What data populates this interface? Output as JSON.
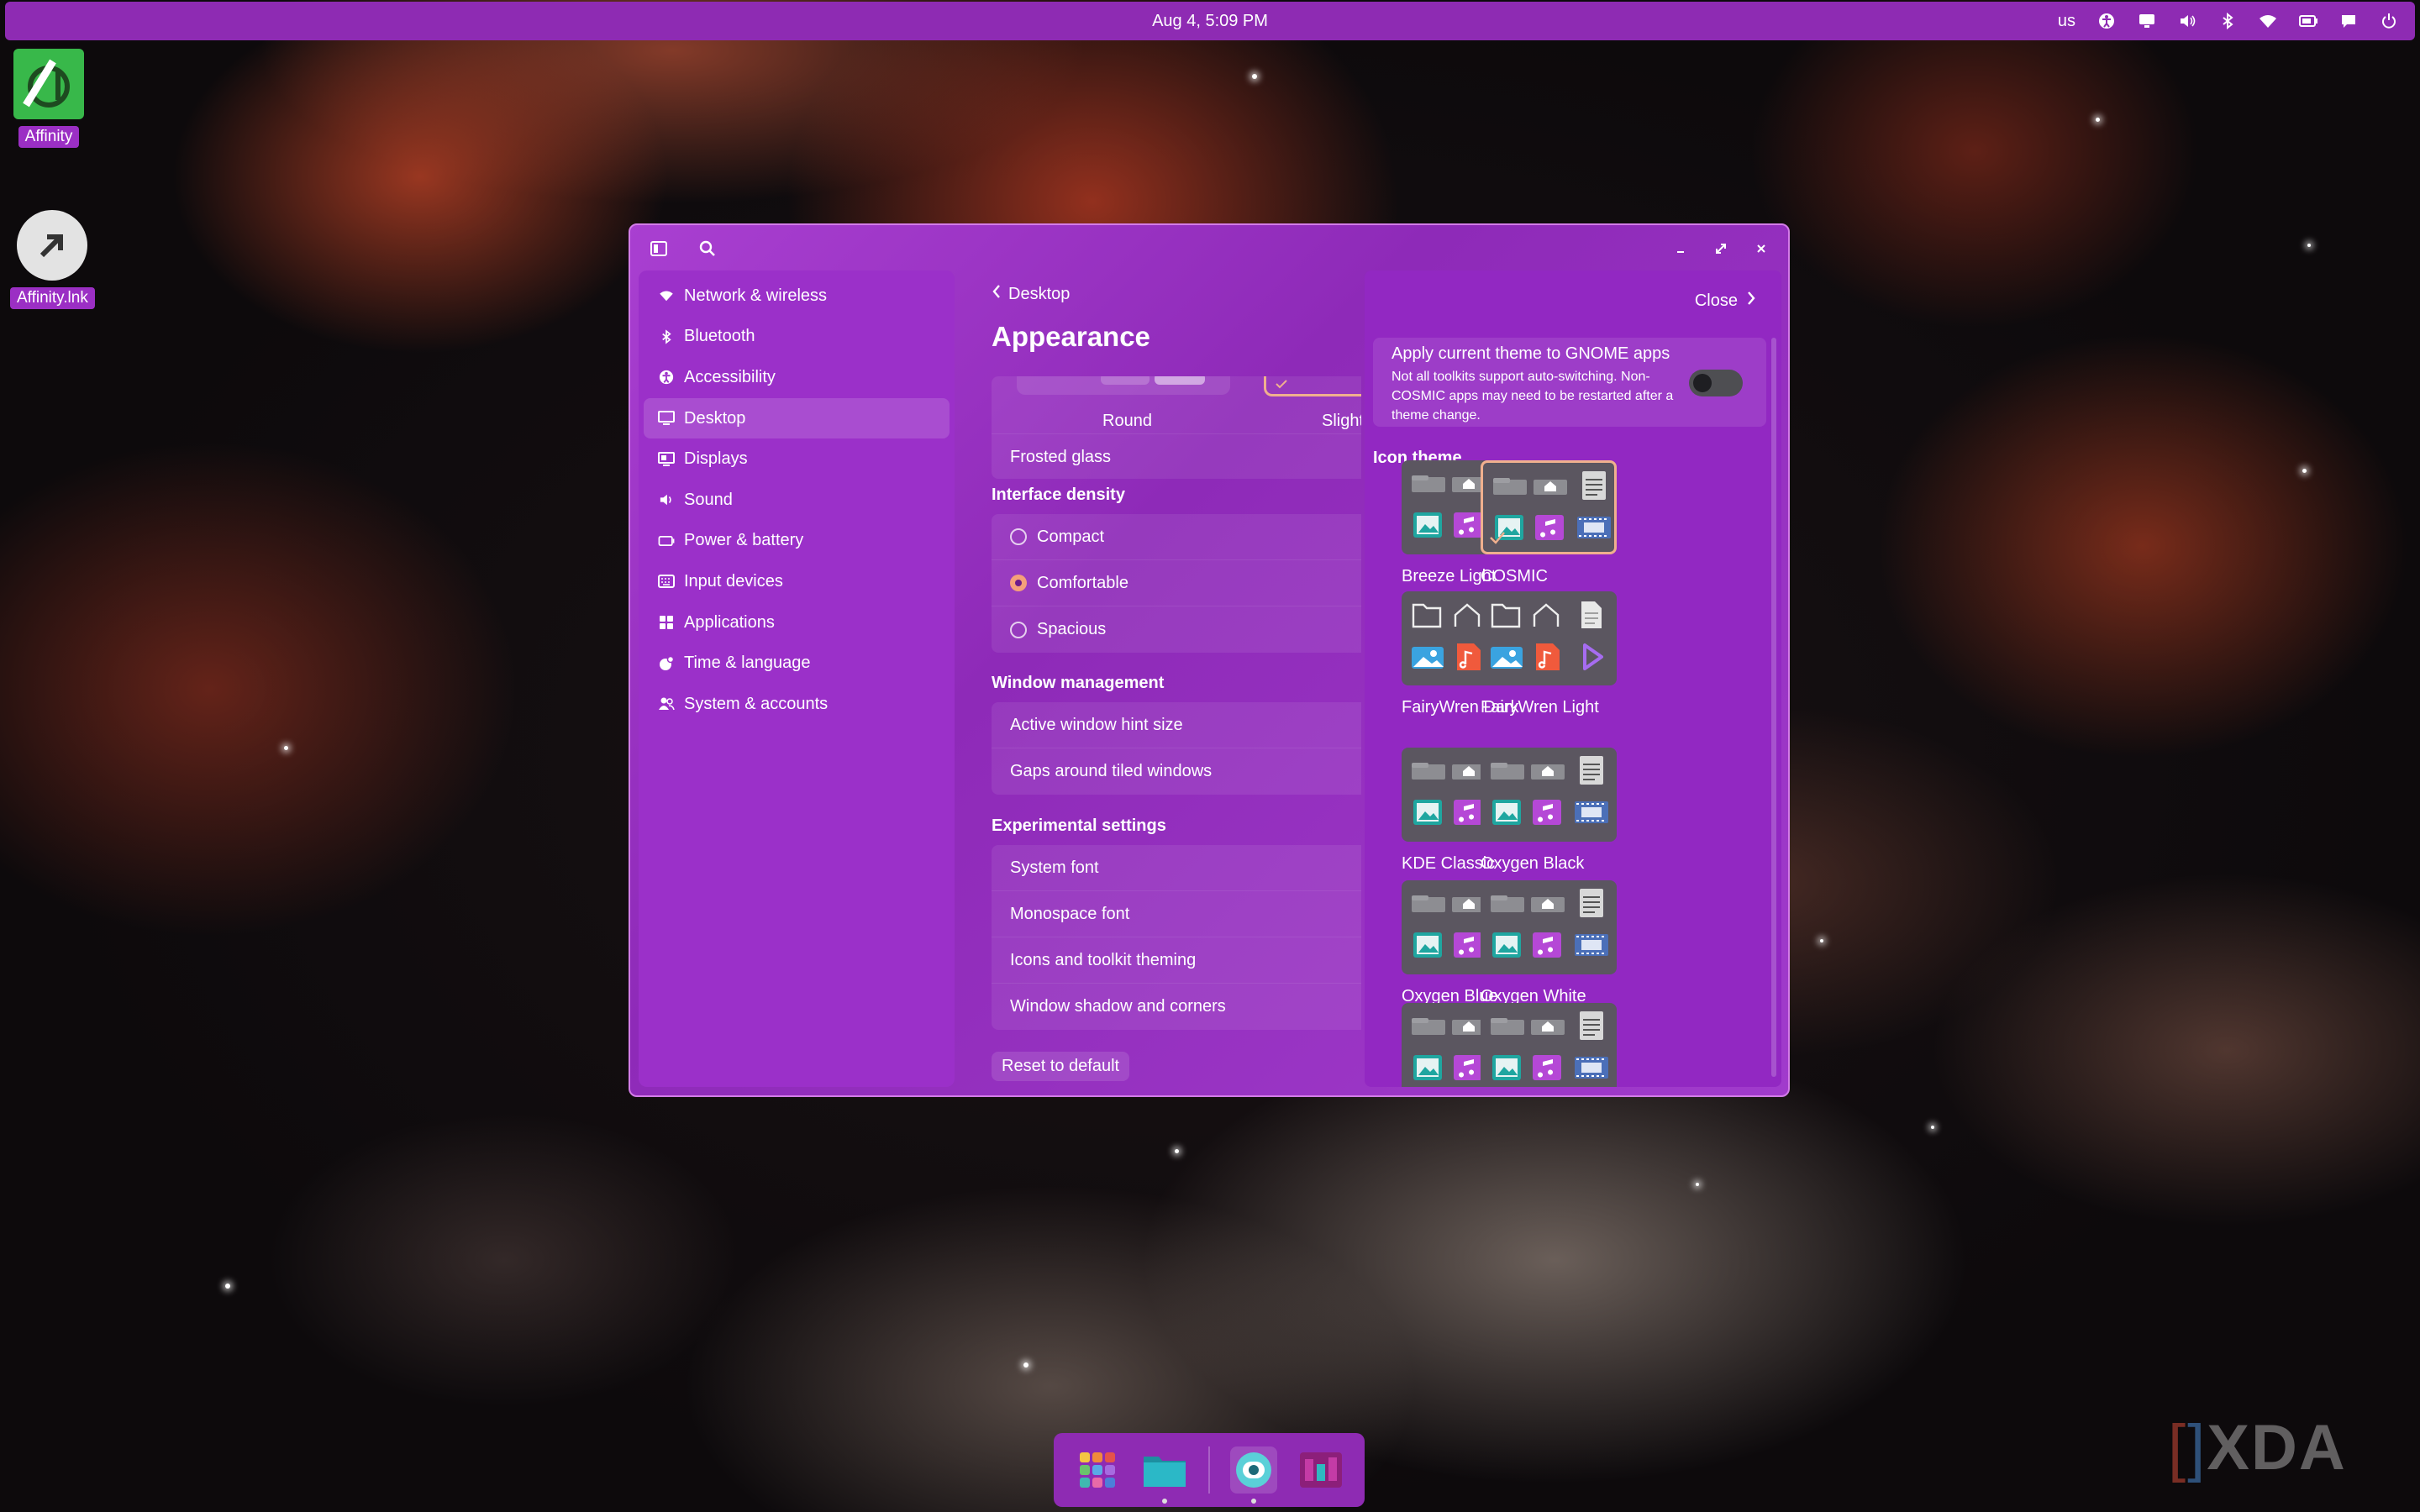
{
  "topbar": {
    "datetime": "Aug 4, 5:09 PM",
    "keyboard_layout": "us",
    "tray_icons": [
      "accessibility-icon",
      "display-icon",
      "volume-icon",
      "bluetooth-icon",
      "wifi-icon",
      "battery-icon",
      "notifications-icon",
      "power-icon"
    ]
  },
  "desktop": {
    "icons": [
      {
        "label": "Affinity"
      },
      {
        "label": "Affinity.lnk"
      }
    ]
  },
  "window": {
    "sidebar": {
      "items": [
        {
          "label": "Network & wireless",
          "icon": "wifi-icon"
        },
        {
          "label": "Bluetooth",
          "icon": "bluetooth-icon"
        },
        {
          "label": "Accessibility",
          "icon": "accessibility-icon"
        },
        {
          "label": "Desktop",
          "icon": "desktop-icon",
          "selected": true
        },
        {
          "label": "Displays",
          "icon": "display-icon"
        },
        {
          "label": "Sound",
          "icon": "sound-icon"
        },
        {
          "label": "Power & battery",
          "icon": "battery-icon"
        },
        {
          "label": "Input devices",
          "icon": "keyboard-icon"
        },
        {
          "label": "Applications",
          "icon": "apps-icon"
        },
        {
          "label": "Time & language",
          "icon": "globe-icon"
        },
        {
          "label": "System & accounts",
          "icon": "users-icon"
        }
      ]
    },
    "main": {
      "back_label": "Desktop",
      "title": "Appearance",
      "roundness_options": {
        "round": "Round",
        "slight": "Slight"
      },
      "frosted_glass": "Frosted glass",
      "density": {
        "heading": "Interface density",
        "options": [
          {
            "label": "Compact",
            "selected": false
          },
          {
            "label": "Comfortable",
            "selected": true
          },
          {
            "label": "Spacious",
            "selected": false
          }
        ]
      },
      "window_management": {
        "heading": "Window management",
        "rows": [
          "Active window hint size",
          "Gaps around tiled windows"
        ]
      },
      "experimental": {
        "heading": "Experimental settings",
        "rows": [
          "System font",
          "Monospace font",
          "Icons and toolkit theming",
          "Window shadow and corners"
        ]
      },
      "reset_label": "Reset to default"
    },
    "drawer": {
      "close_label": "Close",
      "gnome": {
        "title": "Apply current theme to GNOME apps",
        "description": "Not all toolkits support auto-switching. Non-COSMIC apps may need to be restarted after a theme change.",
        "enabled": false
      },
      "icon_theme_heading": "Icon theme",
      "themes": [
        {
          "name": "Breeze Light",
          "style": "breeze",
          "selected": false
        },
        {
          "name": "COSMIC",
          "style": "breeze",
          "selected": true
        },
        {
          "name": "FairyWren Dark",
          "style": "fairy",
          "selected": false
        },
        {
          "name": "FairyWren Light",
          "style": "fairy",
          "selected": false
        },
        {
          "name": "KDE Classic",
          "style": "breeze",
          "selected": false
        },
        {
          "name": "Oxygen Black",
          "style": "breeze",
          "selected": false
        },
        {
          "name": "Oxygen Blue",
          "style": "breeze",
          "selected": false
        },
        {
          "name": "Oxygen White",
          "style": "breeze",
          "selected": false
        },
        {
          "name": "",
          "style": "breeze",
          "selected": false
        },
        {
          "name": "",
          "style": "breeze",
          "selected": false
        }
      ]
    }
  },
  "dock": {
    "apps": [
      {
        "name": "app-launcher-icon",
        "running": false
      },
      {
        "name": "files-icon",
        "running": true
      },
      {
        "name": "settings-icon",
        "running": true
      },
      {
        "name": "store-icon",
        "running": false
      }
    ]
  },
  "watermark": "XDA",
  "colors": {
    "accent": "#9b30c9",
    "panel": "#8e2bb3",
    "selection": "#f0b08e"
  }
}
